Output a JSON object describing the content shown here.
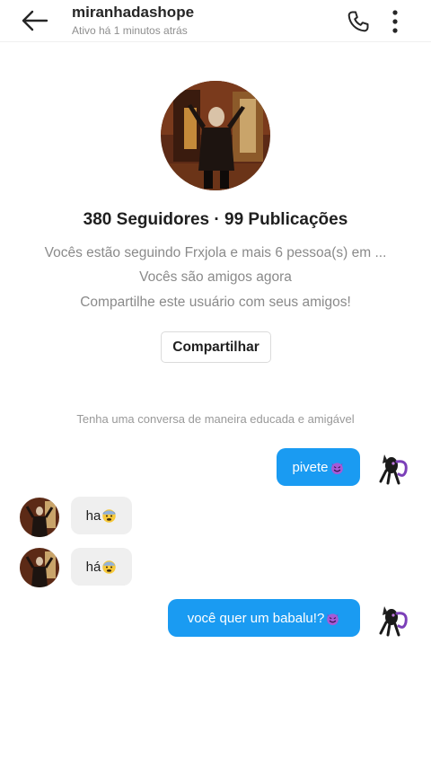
{
  "header": {
    "username": "miranhadashope",
    "status": "Ativo há 1 minutos atrás",
    "icons": [
      "back-arrow-icon",
      "phone-icon",
      "more-vertical-icon"
    ]
  },
  "profile": {
    "stats": "380 Seguidores · 99 Publicações",
    "following_line": "Vocês estão seguindo Frxjola e mais 6 pessoa(s) em ...",
    "friends_line": "Vocês são amigos agora",
    "share_prompt": "Compartilhe este usuário com seus amigos!",
    "share_button": "Compartilhar"
  },
  "chat": {
    "notice": "Tenha uma conversa de maneira educada e amigável",
    "messages": [
      {
        "direction": "outgoing",
        "text": "pivete",
        "emoji": "smiling-devil-emoji"
      },
      {
        "direction": "incoming",
        "text": "ha",
        "emoji": "fearful-face-emoji"
      },
      {
        "direction": "incoming",
        "text": "há",
        "emoji": "fearful-face-emoji"
      },
      {
        "direction": "outgoing",
        "text": "você quer um babalu!?",
        "emoji": "smiling-devil-emoji"
      }
    ]
  },
  "colors": {
    "outgoing_bubble": "#1a9bf2",
    "incoming_bubble": "#efefef",
    "secondary_text": "#8a8a8a"
  }
}
